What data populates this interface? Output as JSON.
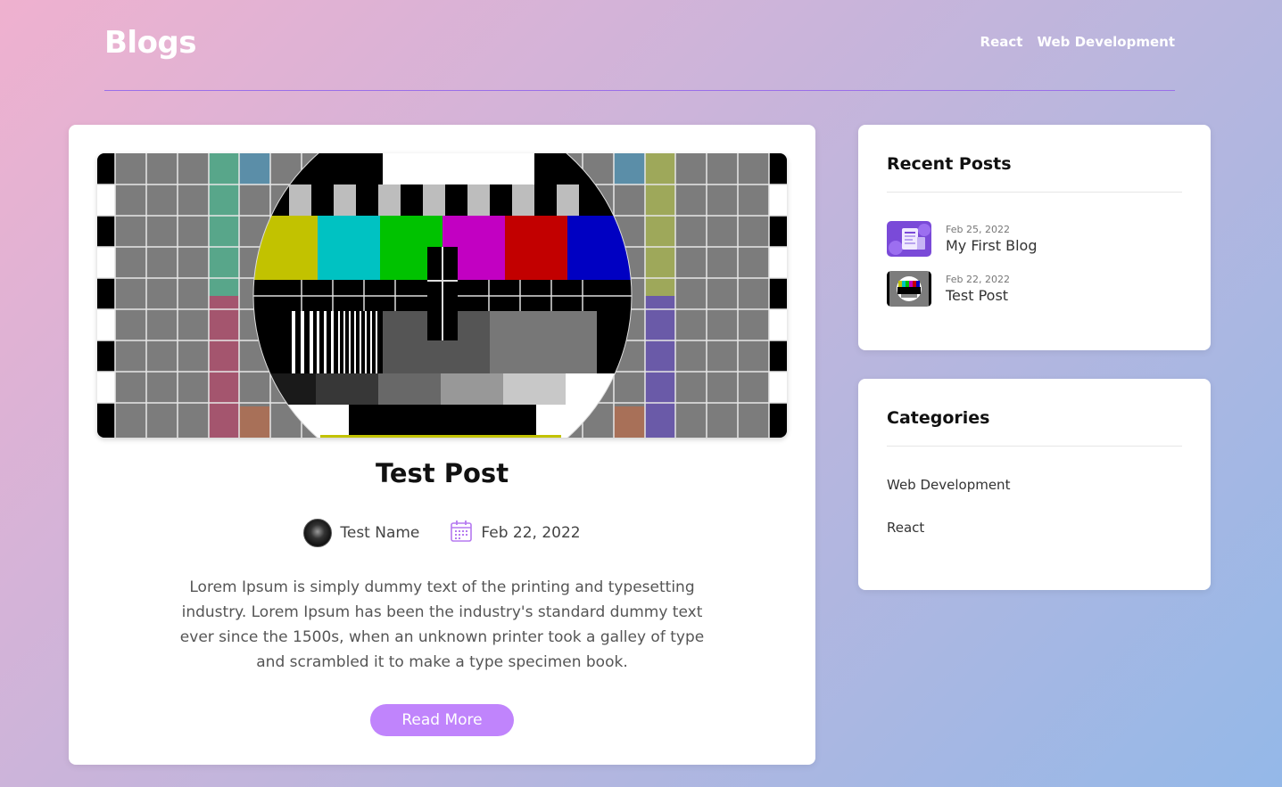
{
  "header": {
    "brand": "Blogs",
    "nav": [
      "React",
      "Web Development"
    ]
  },
  "post": {
    "title": "Test Post",
    "author": "Test Name",
    "date": "Feb 22, 2022",
    "excerpt": "Lorem Ipsum is simply dummy text of the printing and typesetting industry. Lorem Ipsum has been the industry's standard dummy text ever since the 1500s, when an unknown printer took a galley of type and scrambled it to make a type specimen book.",
    "read_more": "Read More",
    "image_icon": "test-card-image",
    "avatar_icon": "user-avatar-icon",
    "calendar_icon": "calendar-icon"
  },
  "recent_posts": {
    "title": "Recent Posts",
    "items": [
      {
        "date": "Feb 25, 2022",
        "title": "My First Blog",
        "thumb": "blog-thumbnail"
      },
      {
        "date": "Feb 22, 2022",
        "title": "Test Post",
        "thumb": "test-card-thumbnail"
      }
    ]
  },
  "categories": {
    "title": "Categories",
    "items": [
      "Web Development",
      "React"
    ]
  },
  "colors": {
    "accent": "#c084fc",
    "header_rule": "#9a6fe8",
    "card": "#ffffff"
  }
}
